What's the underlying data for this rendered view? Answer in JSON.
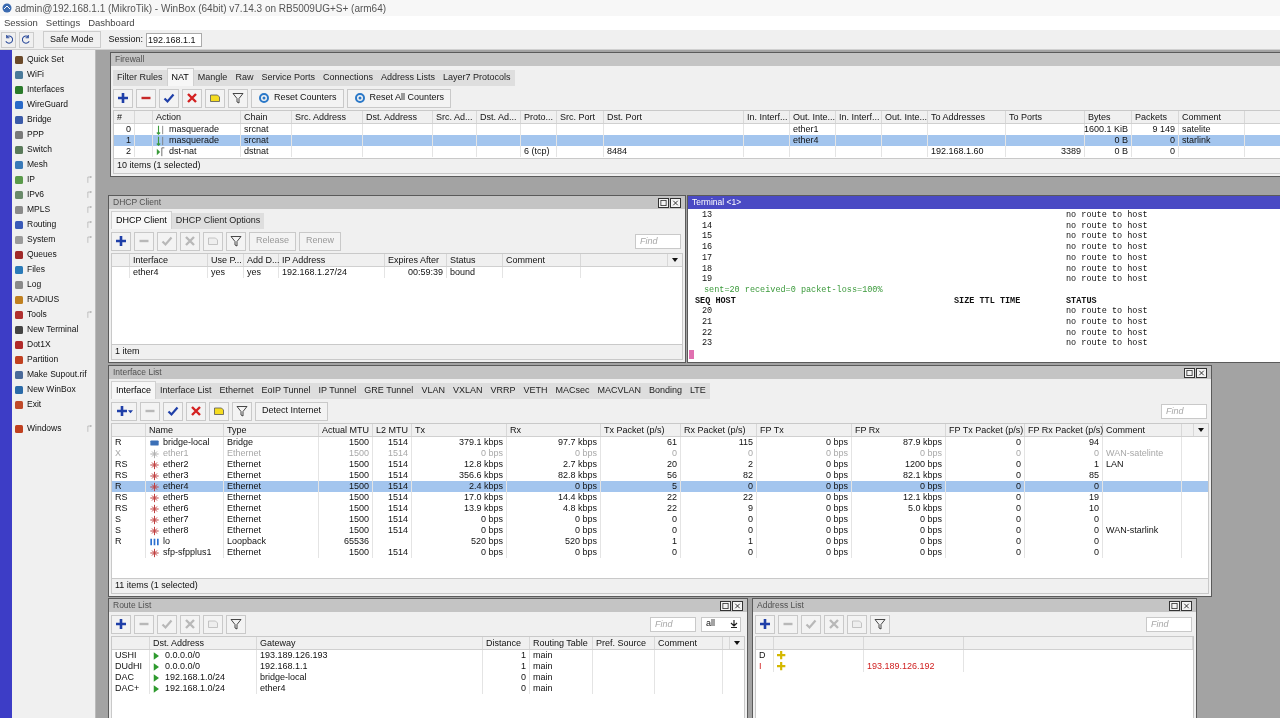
{
  "app": {
    "title": "admin@192.168.1.1 (MikroTik) - WinBox (64bit) v7.14.3 on RB5009UG+S+ (arm64)"
  },
  "menu": [
    "Session",
    "Settings",
    "Dashboard"
  ],
  "toolbar": {
    "safe_mode": "Safe Mode",
    "session_label": "Session:",
    "session_value": "192.168.1.1"
  },
  "sidebar": {
    "items": [
      {
        "label": "Quick Set",
        "submenu": false
      },
      {
        "label": "WiFi",
        "submenu": false
      },
      {
        "label": "Interfaces",
        "submenu": false
      },
      {
        "label": "WireGuard",
        "submenu": false
      },
      {
        "label": "Bridge",
        "submenu": false
      },
      {
        "label": "PPP",
        "submenu": false
      },
      {
        "label": "Switch",
        "submenu": false
      },
      {
        "label": "Mesh",
        "submenu": false
      },
      {
        "label": "IP",
        "submenu": true
      },
      {
        "label": "IPv6",
        "submenu": true
      },
      {
        "label": "MPLS",
        "submenu": true
      },
      {
        "label": "Routing",
        "submenu": true
      },
      {
        "label": "System",
        "submenu": true
      },
      {
        "label": "Queues",
        "submenu": false
      },
      {
        "label": "Files",
        "submenu": false
      },
      {
        "label": "Log",
        "submenu": false
      },
      {
        "label": "RADIUS",
        "submenu": false
      },
      {
        "label": "Tools",
        "submenu": true
      },
      {
        "label": "New Terminal",
        "submenu": false
      },
      {
        "label": "Dot1X",
        "submenu": false
      },
      {
        "label": "Partition",
        "submenu": false
      },
      {
        "label": "Make Supout.rif",
        "submenu": false
      },
      {
        "label": "New WinBox",
        "submenu": false
      },
      {
        "label": "Exit",
        "submenu": false
      }
    ],
    "footer_items": [
      {
        "label": "Windows",
        "submenu": true
      }
    ]
  },
  "firewall": {
    "title": "Firewall",
    "active": false,
    "tabs": [
      {
        "label": "Filter Rules",
        "selected": false
      },
      {
        "label": "NAT",
        "selected": true
      },
      {
        "label": "Mangle",
        "selected": false
      },
      {
        "label": "Raw",
        "selected": false
      },
      {
        "label": "Service Ports",
        "selected": false
      },
      {
        "label": "Connections",
        "selected": false
      },
      {
        "label": "Address Lists",
        "selected": false
      },
      {
        "label": "Layer7 Protocols",
        "selected": false
      }
    ],
    "toolbar": [
      {
        "kind": "add",
        "disabled": false
      },
      {
        "kind": "remove",
        "disabled": false
      },
      {
        "kind": "enable",
        "disabled": false
      },
      {
        "kind": "disable",
        "disabled": false
      },
      {
        "kind": "comment",
        "disabled": false
      },
      {
        "kind": "filter",
        "disabled": false
      },
      {
        "kind": "reset",
        "label": "Reset Counters",
        "disabled": false
      },
      {
        "kind": "reset",
        "label": "Reset All Counters",
        "disabled": false
      }
    ],
    "table": {
      "columns": [
        "#",
        "Action",
        "Chain",
        "Src. Address",
        "Dst. Address",
        "Src. Ad...",
        "Dst. Ad...",
        "Proto...",
        "Src. Port",
        "Dst. Port",
        "In. Interf...",
        "Out. Inte...",
        "In. Interf...",
        "Out. Inte...",
        "To Addresses",
        "To Ports",
        "Bytes",
        "Packets",
        "Comment"
      ],
      "rows": [
        {
          "number": "0",
          "kind": "masquerade",
          "action": "masquerade",
          "chain": "srcnat",
          "out_interface": "ether1",
          "bytes": "1600.1 KiB",
          "packets": "9 149",
          "comment": "satelite",
          "selected": false
        },
        {
          "number": "1",
          "kind": "masquerade",
          "action": "masquerade",
          "chain": "srcnat",
          "out_interface": "ether4",
          "bytes": "0 B",
          "packets": "0",
          "comment": "starlink",
          "selected": true
        },
        {
          "number": "2",
          "kind": "dst_nat",
          "action": "dst-nat",
          "chain": "dstnat",
          "protocol": "6 (tcp)",
          "dst_port": "8484",
          "to_addresses": "192.168.1.60",
          "to_ports": "3389",
          "bytes": "0 B",
          "packets": "0",
          "selected": false
        }
      ]
    },
    "status": "10 items (1 selected)"
  },
  "dhcp_client": {
    "title": "DHCP Client",
    "active": false,
    "tabs": [
      {
        "label": "DHCP Client",
        "selected": true
      },
      {
        "label": "DHCP Client Options",
        "selected": false
      }
    ],
    "toolbar": [
      {
        "kind": "add",
        "disabled": false
      },
      {
        "kind": "remove",
        "disabled": true
      },
      {
        "kind": "enable",
        "disabled": true
      },
      {
        "kind": "disable",
        "disabled": true
      },
      {
        "kind": "comment",
        "disabled": true
      },
      {
        "kind": "filter",
        "disabled": false
      },
      {
        "kind": "button",
        "label": "Release",
        "disabled": true
      },
      {
        "kind": "button",
        "label": "Renew",
        "disabled": true
      }
    ],
    "find": {
      "placeholder": "Find"
    },
    "table": {
      "columns": [
        "Interface",
        "Use P...",
        "Add D...",
        "IP Address",
        "Expires After",
        "Status",
        "Comment"
      ],
      "rows": [
        {
          "interface": "ether4",
          "use_peer_dns": "yes",
          "add_default_route": "yes",
          "ip_address": "192.168.1.27/24",
          "expires_after": "00:59:39",
          "status": "bound",
          "selected": false
        }
      ]
    },
    "status": "1 item"
  },
  "terminal": {
    "title": "Terminal <1>",
    "active": true,
    "lines": [
      {
        "kind": "row",
        "seq": "13",
        "status": "no route to host"
      },
      {
        "kind": "row",
        "seq": "14",
        "status": "no route to host"
      },
      {
        "kind": "row",
        "seq": "15",
        "status": "no route to host"
      },
      {
        "kind": "row",
        "seq": "16",
        "status": "no route to host"
      },
      {
        "kind": "row",
        "seq": "17",
        "status": "no route to host"
      },
      {
        "kind": "row",
        "seq": "18",
        "status": "no route to host"
      },
      {
        "kind": "row",
        "seq": "19",
        "status": "no route to host"
      },
      {
        "kind": "summary",
        "text": "sent=20 received=0 packet-loss=100%"
      },
      {
        "kind": "header",
        "seq": "SEQ HOST",
        "size": "SIZE TTL TIME",
        "status": "STATUS"
      },
      {
        "kind": "row",
        "seq": "20",
        "status": "no route to host"
      },
      {
        "kind": "row",
        "seq": "21",
        "status": "no route to host"
      },
      {
        "kind": "row",
        "seq": "22",
        "status": "no route to host"
      },
      {
        "kind": "row",
        "seq": "23",
        "status": "no route to host"
      }
    ]
  },
  "interface_list": {
    "title": "Interface List",
    "active": false,
    "tabs": [
      {
        "label": "Interface",
        "selected": true
      },
      {
        "label": "Interface List",
        "selected": false
      },
      {
        "label": "Ethernet",
        "selected": false
      },
      {
        "label": "EoIP Tunnel",
        "selected": false
      },
      {
        "label": "IP Tunnel",
        "selected": false
      },
      {
        "label": "GRE Tunnel",
        "selected": false
      },
      {
        "label": "VLAN",
        "selected": false
      },
      {
        "label": "VXLAN",
        "selected": false
      },
      {
        "label": "VRRP",
        "selected": false
      },
      {
        "label": "VETH",
        "selected": false
      },
      {
        "label": "MACsec",
        "selected": false
      },
      {
        "label": "MACVLAN",
        "selected": false
      },
      {
        "label": "Bonding",
        "selected": false
      },
      {
        "label": "LTE",
        "selected": false
      }
    ],
    "toolbar": [
      {
        "kind": "add_menu",
        "disabled": false
      },
      {
        "kind": "remove",
        "disabled": true
      },
      {
        "kind": "enable",
        "disabled": false
      },
      {
        "kind": "disable",
        "disabled": false
      },
      {
        "kind": "comment",
        "disabled": false
      },
      {
        "kind": "filter",
        "disabled": false
      },
      {
        "kind": "button",
        "label": "Detect Internet",
        "disabled": false
      }
    ],
    "find": {
      "placeholder": "Find"
    },
    "table": {
      "columns": [
        "Name",
        "Type",
        "Actual MTU",
        "L2 MTU",
        "Tx",
        "Rx",
        "Tx Packet (p/s)",
        "Rx Packet (p/s)",
        "FP Tx",
        "FP Rx",
        "FP Tx Packet (p/s)",
        "FP Rx Packet (p/s)",
        "Comment"
      ],
      "rows": [
        {
          "flags": "R",
          "kind": "bridge",
          "name": "bridge-local",
          "type": "Bridge",
          "mtu": "1500",
          "l2mtu": "1514",
          "tx": "379.1 kbps",
          "rx": "97.7 kbps",
          "tx_pps": "61",
          "rx_pps": "115",
          "fp_tx": "0 bps",
          "fp_rx": "87.9 kbps",
          "fp_tx_pps": "0",
          "fp_rx_pps": "94",
          "selected": false,
          "disabled": false
        },
        {
          "flags": "X",
          "kind": "ethernet",
          "name": "ether1",
          "type": "Ethernet",
          "mtu": "1500",
          "l2mtu": "1514",
          "tx": "0 bps",
          "rx": "0 bps",
          "tx_pps": "0",
          "rx_pps": "0",
          "fp_tx": "0 bps",
          "fp_rx": "0 bps",
          "fp_tx_pps": "0",
          "fp_rx_pps": "0",
          "comment": "WAN-satelinte",
          "selected": false,
          "disabled": true
        },
        {
          "flags": "RS",
          "kind": "ethernet",
          "name": "ether2",
          "type": "Ethernet",
          "mtu": "1500",
          "l2mtu": "1514",
          "tx": "12.8 kbps",
          "rx": "2.7 kbps",
          "tx_pps": "20",
          "rx_pps": "2",
          "fp_tx": "0 bps",
          "fp_rx": "1200 bps",
          "fp_tx_pps": "0",
          "fp_rx_pps": "1",
          "comment": "LAN",
          "selected": false,
          "disabled": false
        },
        {
          "flags": "RS",
          "kind": "ethernet",
          "name": "ether3",
          "type": "Ethernet",
          "mtu": "1500",
          "l2mtu": "1514",
          "tx": "356.6 kbps",
          "rx": "82.8 kbps",
          "tx_pps": "56",
          "rx_pps": "82",
          "fp_tx": "0 bps",
          "fp_rx": "82.1 kbps",
          "fp_tx_pps": "0",
          "fp_rx_pps": "85",
          "selected": false,
          "disabled": false
        },
        {
          "flags": "R",
          "kind": "ethernet",
          "name": "ether4",
          "type": "Ethernet",
          "mtu": "1500",
          "l2mtu": "1514",
          "tx": "2.4 kbps",
          "rx": "0 bps",
          "tx_pps": "5",
          "rx_pps": "0",
          "fp_tx": "0 bps",
          "fp_rx": "0 bps",
          "fp_tx_pps": "0",
          "fp_rx_pps": "0",
          "selected": true,
          "disabled": false
        },
        {
          "flags": "RS",
          "kind": "ethernet",
          "name": "ether5",
          "type": "Ethernet",
          "mtu": "1500",
          "l2mtu": "1514",
          "tx": "17.0 kbps",
          "rx": "14.4 kbps",
          "tx_pps": "22",
          "rx_pps": "22",
          "fp_tx": "0 bps",
          "fp_rx": "12.1 kbps",
          "fp_tx_pps": "0",
          "fp_rx_pps": "19",
          "selected": false,
          "disabled": false
        },
        {
          "flags": "RS",
          "kind": "ethernet",
          "name": "ether6",
          "type": "Ethernet",
          "mtu": "1500",
          "l2mtu": "1514",
          "tx": "13.9 kbps",
          "rx": "4.8 kbps",
          "tx_pps": "22",
          "rx_pps": "9",
          "fp_tx": "0 bps",
          "fp_rx": "5.0 kbps",
          "fp_tx_pps": "0",
          "fp_rx_pps": "10",
          "selected": false,
          "disabled": false
        },
        {
          "flags": "S",
          "kind": "ethernet",
          "name": "ether7",
          "type": "Ethernet",
          "mtu": "1500",
          "l2mtu": "1514",
          "tx": "0 bps",
          "rx": "0 bps",
          "tx_pps": "0",
          "rx_pps": "0",
          "fp_tx": "0 bps",
          "fp_rx": "0 bps",
          "fp_tx_pps": "0",
          "fp_rx_pps": "0",
          "selected": false,
          "disabled": false
        },
        {
          "flags": "S",
          "kind": "ethernet",
          "name": "ether8",
          "type": "Ethernet",
          "mtu": "1500",
          "l2mtu": "1514",
          "tx": "0 bps",
          "rx": "0 bps",
          "tx_pps": "0",
          "rx_pps": "0",
          "fp_tx": "0 bps",
          "fp_rx": "0 bps",
          "fp_tx_pps": "0",
          "fp_rx_pps": "0",
          "comment": "WAN-starlink",
          "selected": false,
          "disabled": false
        },
        {
          "flags": "R",
          "kind": "loopback",
          "name": "lo",
          "type": "Loopback",
          "mtu": "65536",
          "tx": "520 bps",
          "rx": "520 bps",
          "tx_pps": "1",
          "rx_pps": "1",
          "fp_tx": "0 bps",
          "fp_rx": "0 bps",
          "fp_tx_pps": "0",
          "fp_rx_pps": "0",
          "selected": false,
          "disabled": false
        },
        {
          "kind": "ethernet",
          "name": "sfp-sfpplus1",
          "type": "Ethernet",
          "mtu": "1500",
          "l2mtu": "1514",
          "tx": "0 bps",
          "rx": "0 bps",
          "tx_pps": "0",
          "rx_pps": "0",
          "fp_tx": "0 bps",
          "fp_rx": "0 bps",
          "fp_tx_pps": "0",
          "fp_rx_pps": "0",
          "selected": false,
          "disabled": false
        }
      ]
    },
    "status": "11 items (1 selected)"
  },
  "route_list": {
    "title": "Route List",
    "active": false,
    "toolbar": [
      {
        "kind": "add",
        "disabled": false
      },
      {
        "kind": "remove",
        "disabled": true
      },
      {
        "kind": "enable",
        "disabled": true
      },
      {
        "kind": "disable",
        "disabled": true
      },
      {
        "kind": "comment",
        "disabled": true
      },
      {
        "kind": "filter",
        "disabled": false
      }
    ],
    "find": {
      "placeholder": "Find"
    },
    "selector": {
      "value": "all"
    },
    "table": {
      "columns": [
        "Dst. Address",
        "Gateway",
        "Distance",
        "Routing Table",
        "Pref. Source",
        "Comment"
      ],
      "rows": [
        {
          "flags": "USHI",
          "dst_address": "0.0.0.0/0",
          "gateway": "193.189.126.193",
          "distance": "1",
          "routing_table": "main",
          "selected": false
        },
        {
          "flags": "DUdHI",
          "dst_address": "0.0.0.0/0",
          "gateway": "192.168.1.1",
          "distance": "1",
          "routing_table": "main",
          "selected": false
        },
        {
          "flags": "DAC",
          "dst_address": "192.168.1.0/24",
          "gateway": "bridge-local",
          "distance": "0",
          "routing_table": "main",
          "selected": false
        },
        {
          "flags": "DAC+",
          "dst_address": "192.168.1.0/24",
          "gateway": "ether4",
          "distance": "0",
          "routing_table": "main",
          "selected": false
        }
      ]
    }
  },
  "address_list": {
    "title": "Address List",
    "active": false,
    "toolbar": [
      {
        "kind": "add",
        "disabled": false
      },
      {
        "kind": "remove",
        "disabled": true
      },
      {
        "kind": "enable",
        "disabled": true
      },
      {
        "kind": "disable",
        "disabled": true
      },
      {
        "kind": "comment",
        "disabled": true
      },
      {
        "kind": "filter",
        "disabled": false
      }
    ],
    "find": {
      "placeholder": "Find"
    },
    "table": {
      "rows": [
        {
          "flags": "D",
          "invalid": false,
          "selected": false
        },
        {
          "flags": "I",
          "network": "193.189.126.192",
          "invalid": true,
          "selected": false
        }
      ]
    }
  }
}
